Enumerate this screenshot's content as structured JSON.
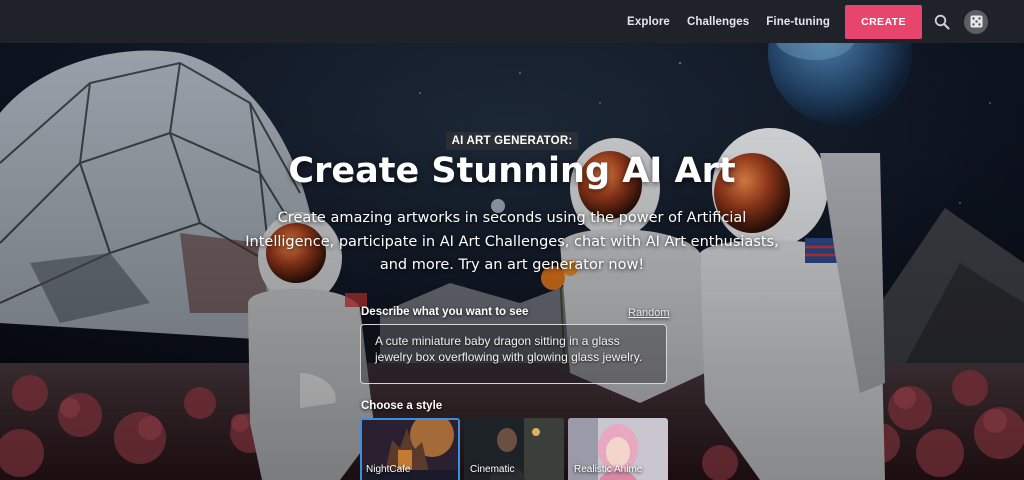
{
  "nav": {
    "links": [
      "Explore",
      "Challenges",
      "Fine-tuning"
    ],
    "create_label": "CREATE",
    "search_icon": "search-icon",
    "random_icon": "dice-icon"
  },
  "hero": {
    "badge": "AI ART GENERATOR:",
    "title": "Create Stunning AI Art",
    "subtitle": "Create amazing artworks in seconds using the power of Artificial Intelligence, participate in AI Art Challenges, chat with AI Art enthusiasts, and more. Try an art generator now!"
  },
  "prompt": {
    "label": "Describe what you want to see",
    "random_label": "Random",
    "value": "A cute miniature baby dragon sitting in a glass jewelry box overflowing with glowing glass jewelry."
  },
  "styles": {
    "label": "Choose a style",
    "items": [
      {
        "name": "NightCafe",
        "selected": true
      },
      {
        "name": "Cinematic",
        "selected": false
      },
      {
        "name": "Realistic Anime",
        "selected": false
      }
    ]
  },
  "colors": {
    "accent": "#e8456e",
    "nav_bg": "#1f2329",
    "selected_border": "#3b8fe0"
  }
}
